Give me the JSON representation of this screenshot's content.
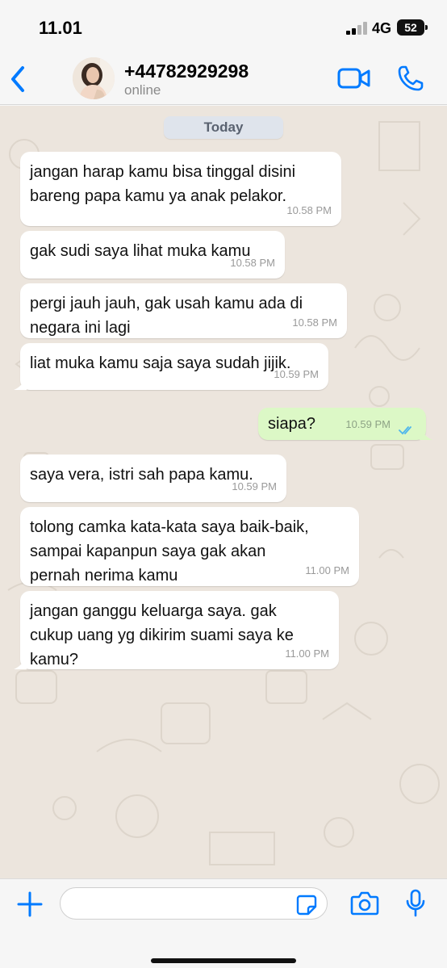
{
  "status_bar": {
    "time": "11.01",
    "network": "4G",
    "battery": "52"
  },
  "header": {
    "contact_name": "+44782929298",
    "contact_status": "online"
  },
  "chat": {
    "date_label": "Today",
    "messages": [
      {
        "direction": "in",
        "text": "jangan harap kamu bisa tinggal disini\nbareng papa kamu ya anak pelakor.",
        "time": "10.58 PM"
      },
      {
        "direction": "in",
        "text": "gak sudi saya lihat muka kamu",
        "time": "10.58 PM"
      },
      {
        "direction": "in",
        "text": "pergi jauh jauh, gak usah kamu ada di\nnegara ini lagi",
        "time": "10.58 PM"
      },
      {
        "direction": "in",
        "text": "liat muka kamu saja saya sudah jijik.",
        "time": "10.59 PM"
      },
      {
        "direction": "out",
        "text": "siapa?",
        "time": "10.59 PM"
      },
      {
        "direction": "in",
        "text": "saya vera, istri sah papa kamu.",
        "time": "10.59 PM"
      },
      {
        "direction": "in",
        "text": "tolong camka kata-kata saya baik-baik,\nsampai kapanpun saya gak akan\npernah nerima kamu",
        "time": "11.00 PM"
      },
      {
        "direction": "in",
        "text": "jangan ganggu keluarga saya. gak\ncukup uang yg dikirim suami saya ke\nkamu?",
        "time": "11.00 PM"
      }
    ]
  },
  "input": {
    "value": "",
    "placeholder": ""
  },
  "colors": {
    "accent": "#007aff",
    "outgoing_bubble": "#dcf8c6",
    "incoming_bubble": "#ffffff",
    "wallpaper": "#ece5dd",
    "read_ticks": "#4fb6ec"
  },
  "icons": {
    "back": "chevron-left-icon",
    "video": "video-camera-icon",
    "call": "phone-icon",
    "plus": "plus-icon",
    "sticker": "sticker-icon",
    "camera": "camera-icon",
    "mic": "microphone-icon",
    "read": "double-check-icon"
  }
}
